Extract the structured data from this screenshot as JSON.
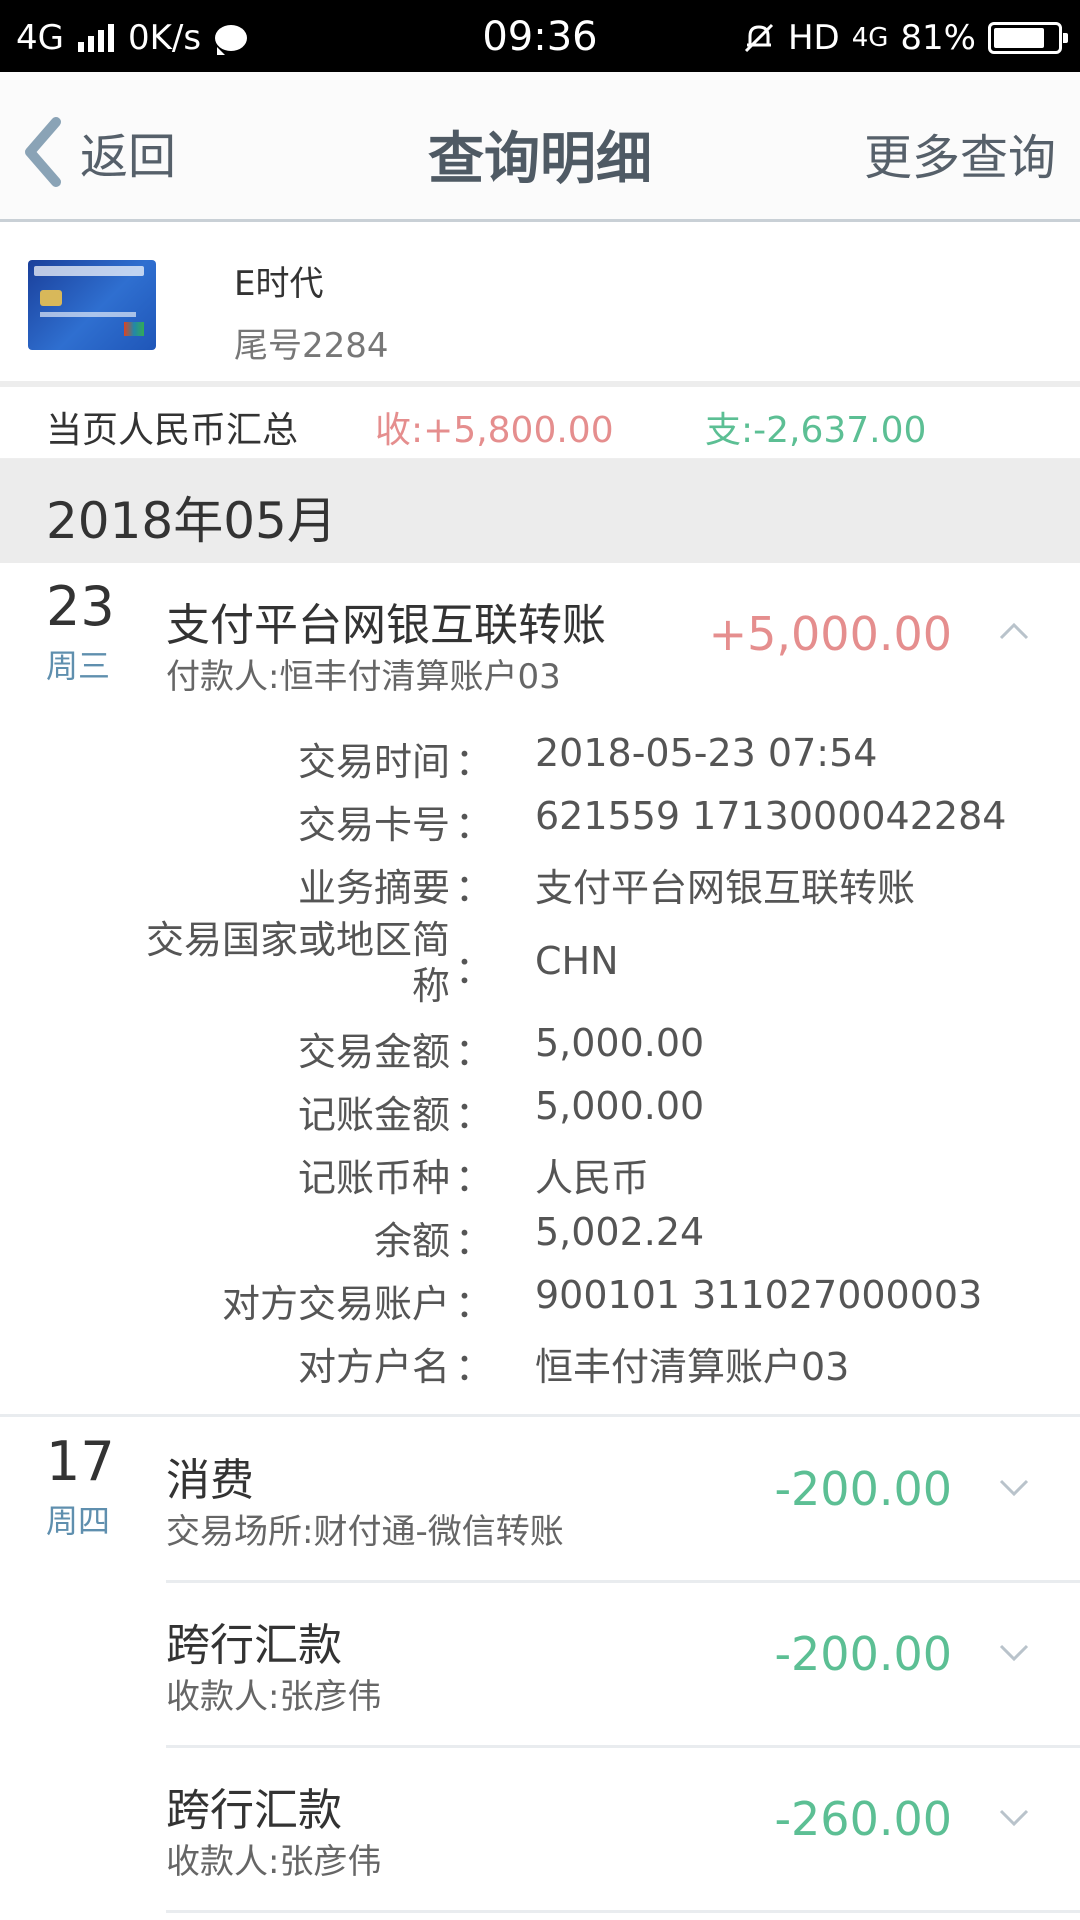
{
  "status_bar": {
    "network": "4G",
    "speed": "0K/s",
    "time": "09:36",
    "hd": "HD",
    "network_right": "4G",
    "battery": "81%",
    "battery_level": 0.81
  },
  "nav": {
    "back_label": "返回",
    "title": "查询明细",
    "more_label": "更多查询"
  },
  "card": {
    "name": "E时代",
    "tail": "尾号2284"
  },
  "summary": {
    "label": "当页人民币汇总",
    "income": "收:+5,800.00",
    "expense": "支:-2,637.00"
  },
  "month": "2018年05月",
  "colors": {
    "income": "#e58e8e",
    "expense": "#5cbf94",
    "weekday": "#5f8fae"
  },
  "transactions": [
    {
      "day": "23",
      "weekday": "周三",
      "title": "支付平台网银互联转账",
      "sub": "付款人:恒丰付清算账户03",
      "amount": "+5,000.00",
      "expanded": true,
      "details": [
        {
          "label": "交易时间",
          "value": "2018-05-23 07:54"
        },
        {
          "label": "交易卡号",
          "value": "621559 1713000042284"
        },
        {
          "label": "业务摘要",
          "value": "支付平台网银互联转账"
        },
        {
          "label": "交易国家或地区简称",
          "value": "CHN"
        },
        {
          "label": "交易金额",
          "value": "5,000.00"
        },
        {
          "label": "记账金额",
          "value": "5,000.00"
        },
        {
          "label": "记账币种",
          "value": "人民币"
        },
        {
          "label": "余额",
          "value": "5,002.24"
        },
        {
          "label": "对方交易账户",
          "value": "900101 311027000003"
        },
        {
          "label": "对方户名",
          "value": "恒丰付清算账户03"
        }
      ],
      "detail_colon": "："
    },
    {
      "day": "17",
      "weekday": "周四",
      "title": "消费",
      "sub": "交易场所:财付通-微信转账",
      "amount": "-200.00"
    },
    {
      "title": "跨行汇款",
      "sub": "收款人:张彦伟",
      "amount": "-200.00"
    },
    {
      "title": "跨行汇款",
      "sub": "收款人:张彦伟",
      "amount": "-260.00"
    }
  ]
}
